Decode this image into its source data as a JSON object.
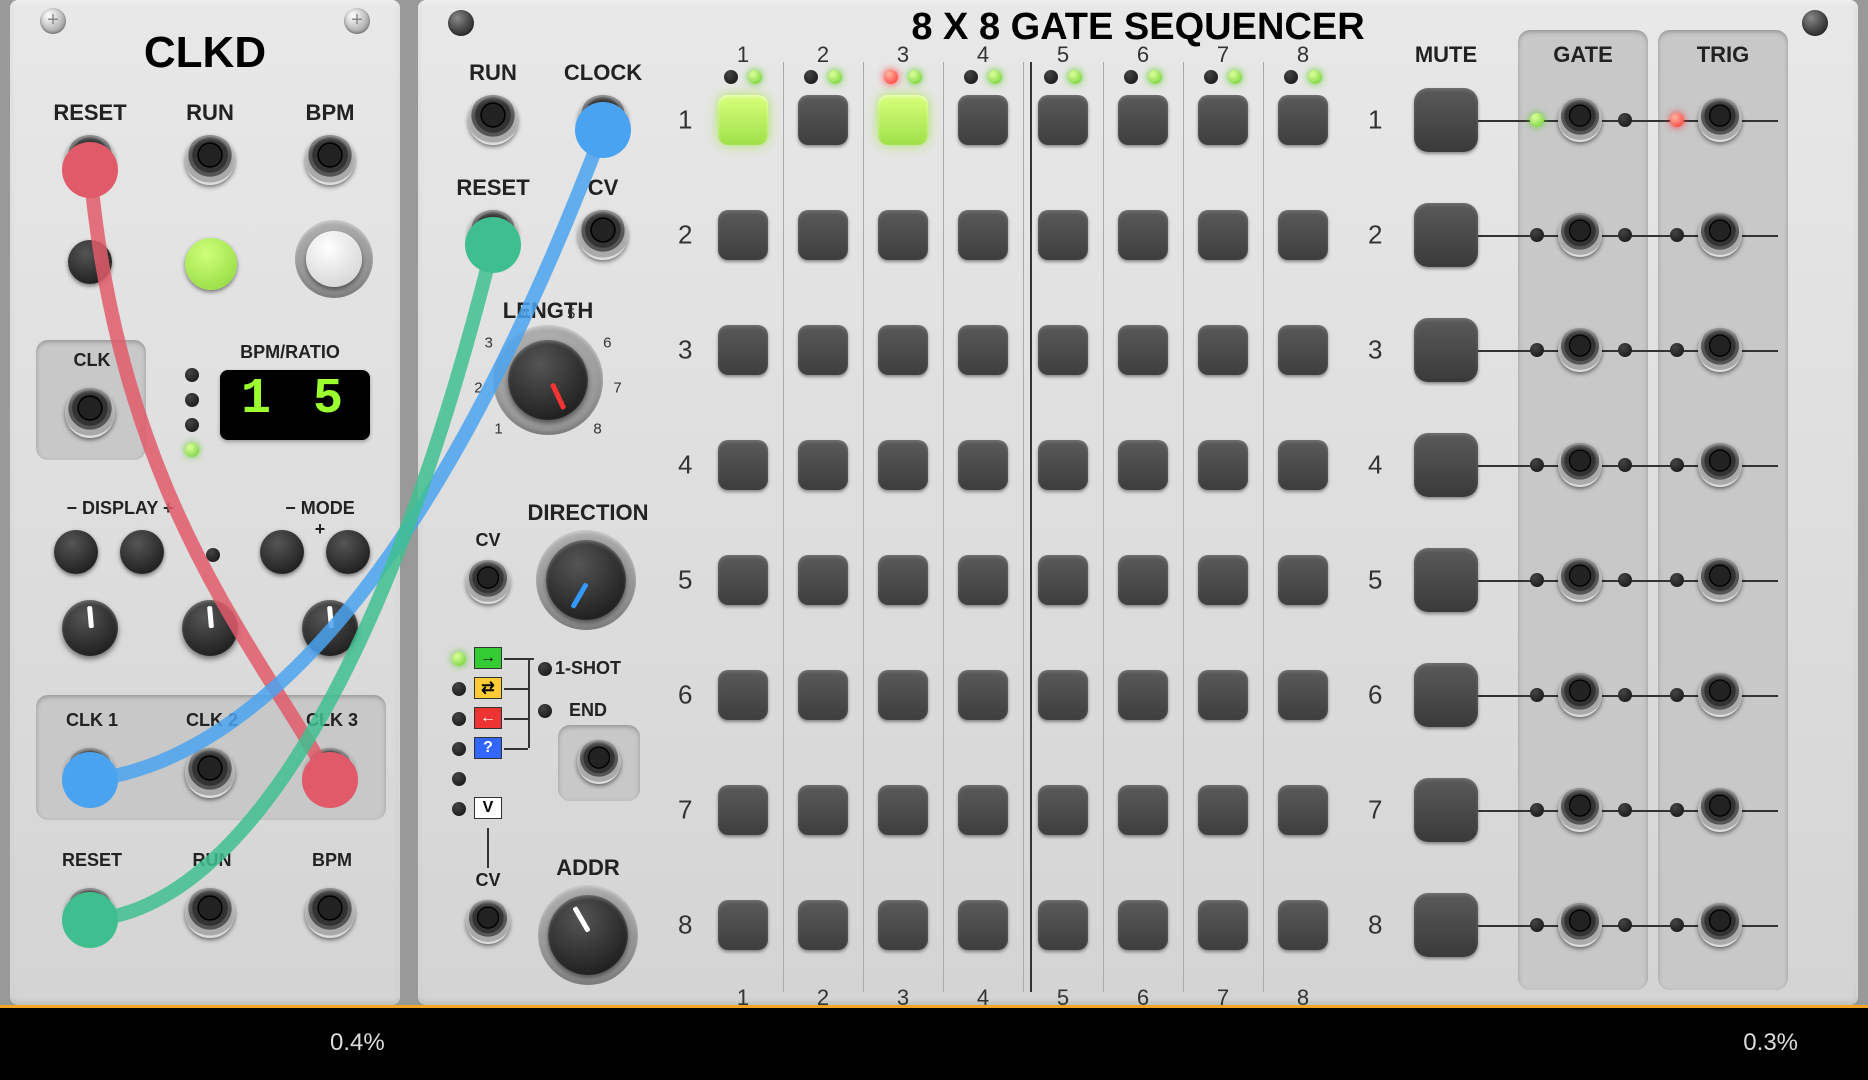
{
  "clkd": {
    "title": "CLKD",
    "labels": {
      "reset": "RESET",
      "run": "RUN",
      "bpm": "BPM",
      "clk": "CLK",
      "bpm_ratio": "BPM/RATIO",
      "display_header": "− DISPLAY +",
      "mode_header": "− MODE +",
      "clk1": "CLK 1",
      "clk2": "CLK 2",
      "clk3": "CLK 3",
      "reset2": "RESET",
      "run2": "RUN",
      "bpm2": "BPM"
    },
    "display_value": "1 5"
  },
  "seq": {
    "title": "8 X 8 GATE SEQUENCER",
    "labels": {
      "run": "RUN",
      "clock": "CLOCK",
      "reset": "RESET",
      "cv": "CV",
      "length": "LENGTH",
      "direction": "DIRECTION",
      "one_shot": "1-SHOT",
      "end": "END",
      "cv2": "CV",
      "addr": "ADDR",
      "voltage_mode": "V",
      "mute": "MUTE",
      "gate": "GATE",
      "trig": "TRIG"
    },
    "length_knob_ticks": [
      "1",
      "2",
      "3",
      "4",
      "5",
      "6",
      "7",
      "8"
    ],
    "cols": [
      1,
      2,
      3,
      4,
      5,
      6,
      7,
      8
    ],
    "rows": [
      1,
      2,
      3,
      4,
      5,
      6,
      7,
      8
    ],
    "active_cells": [
      [
        0,
        0
      ],
      [
        0,
        2
      ]
    ],
    "step_led_red": 2,
    "gate_row_led_on": 0,
    "trig_row_led_on": 0
  },
  "bottom": {
    "left_pct": "0.4%",
    "right_pct": "0.3%"
  },
  "cables": [
    {
      "color": "#e05a6a",
      "from": "clkd.reset_in",
      "to": "clkd.clk3"
    },
    {
      "color": "#4aa3f0",
      "from": "clkd.clk1",
      "to": "seq.clock"
    },
    {
      "color": "#3fbf8f",
      "from": "clkd.reset_out",
      "to": "seq.reset"
    }
  ]
}
